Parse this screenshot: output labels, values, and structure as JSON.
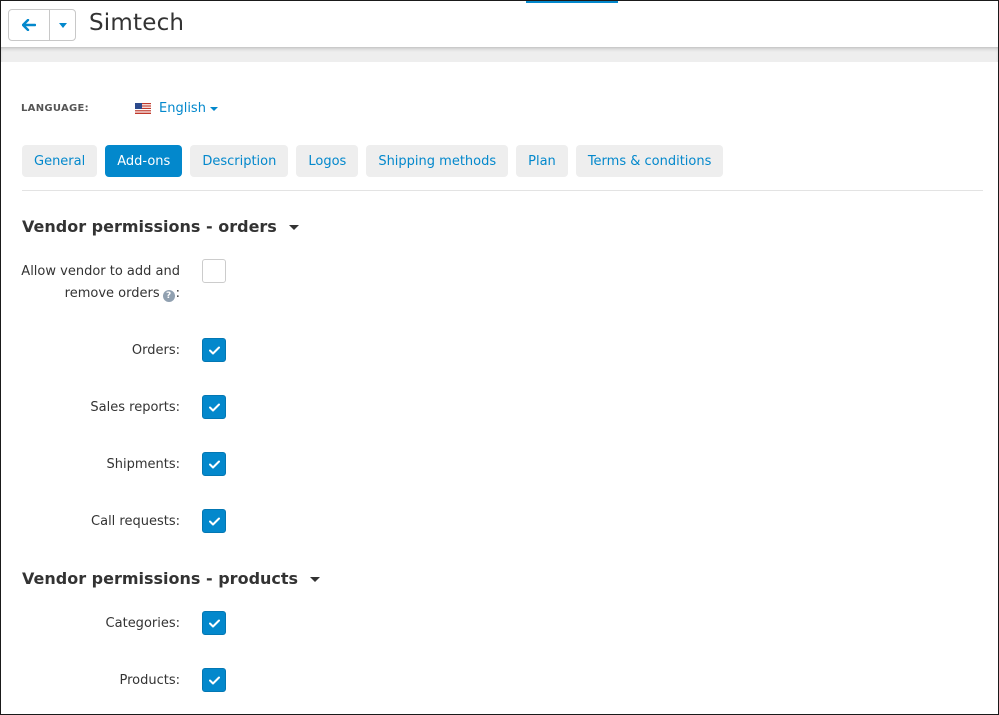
{
  "header": {
    "title": "Simtech",
    "back_icon": "arrow-left-icon",
    "dropdown_icon": "caret-down-icon"
  },
  "language": {
    "label": "LANGUAGE:",
    "selected": "English",
    "flag_icon": "us-flag-icon"
  },
  "tabs": [
    {
      "label": "General",
      "active": false
    },
    {
      "label": "Add-ons",
      "active": true
    },
    {
      "label": "Description",
      "active": false
    },
    {
      "label": "Logos",
      "active": false
    },
    {
      "label": "Shipping methods",
      "active": false
    },
    {
      "label": "Plan",
      "active": false
    },
    {
      "label": "Terms & conditions",
      "active": false
    }
  ],
  "sections": {
    "orders": {
      "title": "Vendor permissions - orders",
      "fields": {
        "add_remove": {
          "label_line1": "Allow vendor to add and",
          "label_line2": "remove orders",
          "label_suffix": ":",
          "checked": false
        },
        "orders": {
          "label": "Orders:",
          "checked": true
        },
        "sales_reports": {
          "label": "Sales reports:",
          "checked": true
        },
        "shipments": {
          "label": "Shipments:",
          "checked": true
        },
        "call_requests": {
          "label": "Call requests:",
          "checked": true
        }
      }
    },
    "products": {
      "title": "Vendor permissions - products",
      "fields": {
        "categories": {
          "label": "Categories:",
          "checked": true
        },
        "products": {
          "label": "Products:",
          "checked": true
        }
      }
    }
  },
  "colors": {
    "accent": "#0388cc",
    "tab_bg": "#eeeeee",
    "text": "#333333"
  }
}
